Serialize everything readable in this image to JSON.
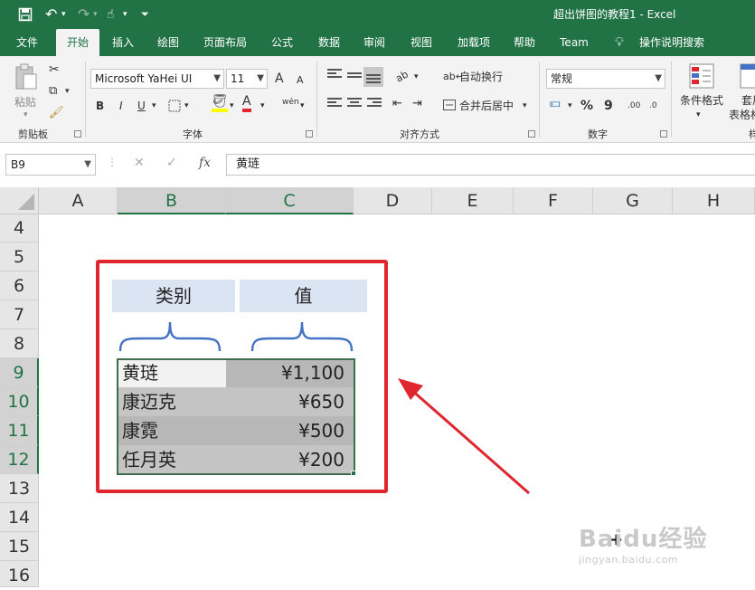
{
  "titlebar": {
    "title": "超出饼图的教程1  -  Excel",
    "save_icon": "save-icon",
    "undo_icon": "undo-icon",
    "redo_icon": "redo-icon",
    "touch_icon": "touch-mode-icon",
    "customize_icon": "customize-qat-icon"
  },
  "tabs": [
    "文件",
    "开始",
    "插入",
    "绘图",
    "页面布局",
    "公式",
    "数据",
    "审阅",
    "视图",
    "加载项",
    "帮助",
    "Team",
    "操作说明搜索"
  ],
  "ribbon": {
    "clipboard": {
      "paste_label": "粘贴",
      "group_label": "剪贴板"
    },
    "font": {
      "font_name": "Microsoft YaHei UI",
      "font_size": "11",
      "bold": "B",
      "italic": "I",
      "underline": "U",
      "group_label": "字体",
      "grow": "A",
      "shrink": "A",
      "phonetic": "wén"
    },
    "alignment": {
      "wrap_text": "自动换行",
      "merge_center": "合并后居中",
      "group_label": "对齐方式",
      "orientation": "ab"
    },
    "number": {
      "format": "常规",
      "percent": "%",
      "comma": "9",
      "inc_decimal": ".00",
      "dec_decimal": ".0",
      "group_label": "数字"
    },
    "styles": {
      "conditional_format": "条件格式",
      "table_format": "套用",
      "table_format_line2": "表格格",
      "cut_label": "样"
    }
  },
  "formula_bar": {
    "name_box": "B9",
    "cancel": "✕",
    "enter": "✓",
    "fx": "fx",
    "content": "黄琏"
  },
  "grid": {
    "columns": [
      "A",
      "B",
      "C",
      "D",
      "E",
      "F",
      "G",
      "H"
    ],
    "rows": [
      "4",
      "5",
      "6",
      "7",
      "8",
      "9",
      "10",
      "11",
      "12",
      "13",
      "14",
      "15",
      "16"
    ]
  },
  "table": {
    "header_category": "类别",
    "header_value": "值",
    "rows": [
      {
        "category": "黄琏",
        "value": "¥1,100"
      },
      {
        "category": "康迈克",
        "value": "¥650"
      },
      {
        "category": "康霓",
        "value": "¥500"
      },
      {
        "category": "任月英",
        "value": "¥200"
      }
    ]
  },
  "colors": {
    "excel_green": "#217346",
    "annotation_red": "#e0262f",
    "header_fill": "#dbe4f3",
    "brace_blue": "#4472c4"
  },
  "watermark": {
    "brand": "Baidu经验",
    "url": "jingyan.baidu.com"
  }
}
